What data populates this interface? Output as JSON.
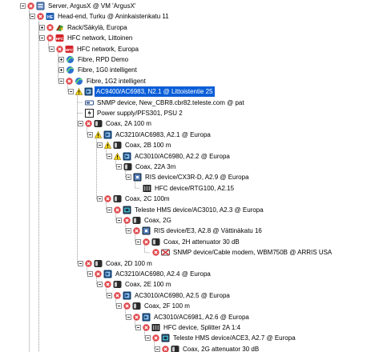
{
  "tree": {
    "rows": [
      {
        "level": 0,
        "status": "error",
        "icon": "server-icon",
        "expander": "expanded",
        "label": "Server, ArgusX @ VM 'ArgusX'"
      },
      {
        "level": 1,
        "status": "error",
        "icon": "headend-icon",
        "expander": "expanded",
        "label": "Head-end, Turku @ Aninkaistenkatu 11"
      },
      {
        "level": 2,
        "status": "error",
        "icon": "rack-icon",
        "expander": "collapsed",
        "label": "Rack/Säkylä, Europa"
      },
      {
        "level": 2,
        "status": "error",
        "icon": "hfc-network-icon",
        "expander": "expanded",
        "label": "HFC network, Littoinen"
      },
      {
        "level": 3,
        "status": "error",
        "icon": "hfc-network-icon",
        "expander": "expanded",
        "label": "HFC network, Europa"
      },
      {
        "level": 4,
        "status": "none",
        "icon": "fibre-icon",
        "expander": "collapsed",
        "label": "Fibre, RPD Demo"
      },
      {
        "level": 4,
        "status": "none",
        "icon": "fibre-icon",
        "expander": "collapsed",
        "label": "Fibre, 1G0 intelligent"
      },
      {
        "level": 4,
        "status": "error",
        "icon": "fibre-icon",
        "expander": "expanded",
        "label": "Fibre, 1G2 intelligent"
      },
      {
        "level": 5,
        "status": "warning",
        "icon": "amplifier-icon",
        "expander": "expanded",
        "label": "AC9400/AC6983, N2.1 @ Littoistentie 25",
        "selected": true
      },
      {
        "level": 6,
        "status": "none",
        "icon": "snmp-device-icon",
        "expander": "none",
        "label": "SNMP device, New_CBR8.cbr82.teleste.com @ pat"
      },
      {
        "level": 6,
        "status": "none",
        "icon": "power-supply-icon",
        "expander": "none",
        "label": "Power supply/PFS301, PSU 2"
      },
      {
        "level": 6,
        "status": "error",
        "icon": "coax-icon",
        "expander": "expanded",
        "label": "Coax, 2A 100 m"
      },
      {
        "level": 7,
        "status": "warning",
        "icon": "amplifier-icon",
        "expander": "expanded",
        "label": "AC3210/AC6983, A2.1 @ Europa"
      },
      {
        "level": 8,
        "status": "warning",
        "icon": "coax-icon",
        "expander": "expanded",
        "label": "Coax, 2B 100 m"
      },
      {
        "level": 9,
        "status": "warning",
        "icon": "amplifier-icon",
        "expander": "expanded",
        "label": "AC3010/AC6980, A2.2 @ Europa"
      },
      {
        "level": 10,
        "status": "none",
        "icon": "coax-icon",
        "expander": "expanded",
        "label": "Coax, 22A 3m"
      },
      {
        "level": 11,
        "status": "none",
        "icon": "ris-device-icon",
        "expander": "expanded",
        "label": "RIS device/CX3R-D, A2.9 @ Europa"
      },
      {
        "level": 12,
        "status": "none",
        "icon": "hfc-device-icon",
        "expander": "none",
        "label": "HFC device/RTG100, A2.15"
      },
      {
        "level": 8,
        "status": "error",
        "icon": "coax-icon",
        "expander": "expanded",
        "label": "Coax, 2C 100m"
      },
      {
        "level": 9,
        "status": "error",
        "icon": "hms-device-icon",
        "expander": "expanded",
        "label": "Teleste HMS device/AC3010, A2.3 @ Europa"
      },
      {
        "level": 10,
        "status": "error",
        "icon": "coax-icon",
        "expander": "expanded",
        "label": "Coax, 2G"
      },
      {
        "level": 11,
        "status": "error",
        "icon": "ris-device-icon",
        "expander": "expanded",
        "label": "RIS device/E3, A2.8 @ Vättinäkatu 16"
      },
      {
        "level": 12,
        "status": "error",
        "icon": "coax-icon",
        "expander": "expanded",
        "label": "Coax, 2H attenuator 30 dB"
      },
      {
        "level": 13,
        "status": "error",
        "icon": "cable-modem-icon",
        "expander": "none",
        "label": "SNMP device/Cable modem, WBM750B @ ARRIS USA"
      },
      {
        "level": 6,
        "status": "error",
        "icon": "coax-icon",
        "expander": "expanded",
        "label": "Coax, 2D 100 m"
      },
      {
        "level": 7,
        "status": "error",
        "icon": "amplifier-icon",
        "expander": "expanded",
        "label": "AC3210/AC6980, A2.4 @ Europa"
      },
      {
        "level": 8,
        "status": "error",
        "icon": "coax-icon",
        "expander": "expanded",
        "label": "Coax, 2E 100 m"
      },
      {
        "level": 9,
        "status": "error",
        "icon": "amplifier-icon",
        "expander": "expanded",
        "label": "AC3010/AC6980, A2.5 @ Europa"
      },
      {
        "level": 10,
        "status": "error",
        "icon": "coax-icon",
        "expander": "expanded",
        "label": "Coax, 2F 100 m"
      },
      {
        "level": 11,
        "status": "error",
        "icon": "amplifier-icon",
        "expander": "expanded",
        "label": "AC3010/AC6981, A2.6 @ Europa"
      },
      {
        "level": 12,
        "status": "error",
        "icon": "hfc-device-icon",
        "expander": "expanded",
        "label": "HFC device, Splitter 2A 1:4"
      },
      {
        "level": 13,
        "status": "error",
        "icon": "hms-device-icon",
        "expander": "expanded",
        "label": "Teleste HMS device/ACE3, A2.7 @ Europa"
      },
      {
        "level": 14,
        "status": "error",
        "icon": "coax-icon",
        "expander": "expanded",
        "label": "Coax, 2G attenuator 30 dB"
      }
    ]
  },
  "colors": {
    "selection": "#0a5ed8",
    "error": "#e0464a",
    "warning": "#f2d21b",
    "guide": "#9a9a9a"
  }
}
